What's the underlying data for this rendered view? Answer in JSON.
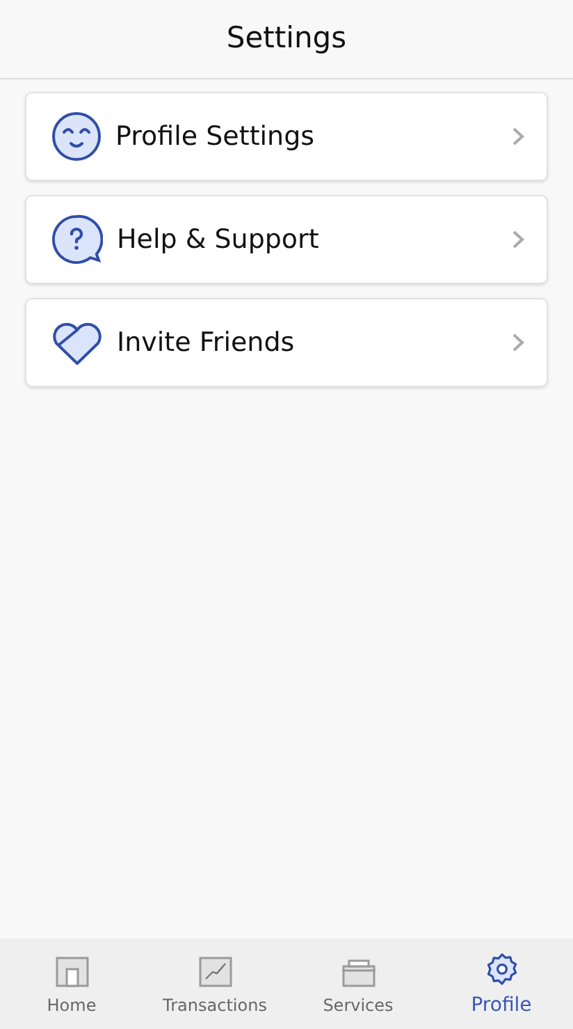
{
  "header": {
    "title": "Settings"
  },
  "items": [
    {
      "kind": "smile",
      "label": "Profile Settings"
    },
    {
      "kind": "help",
      "label": "Help & Support"
    },
    {
      "kind": "heart",
      "label": "Invite Friends"
    }
  ],
  "tabs": [
    {
      "kind": "home",
      "label": "Home",
      "selected": false
    },
    {
      "kind": "chart",
      "label": "Transactions",
      "selected": false
    },
    {
      "kind": "box",
      "label": "Services",
      "selected": false
    },
    {
      "kind": "gear",
      "label": "Profile",
      "selected": true
    }
  ]
}
